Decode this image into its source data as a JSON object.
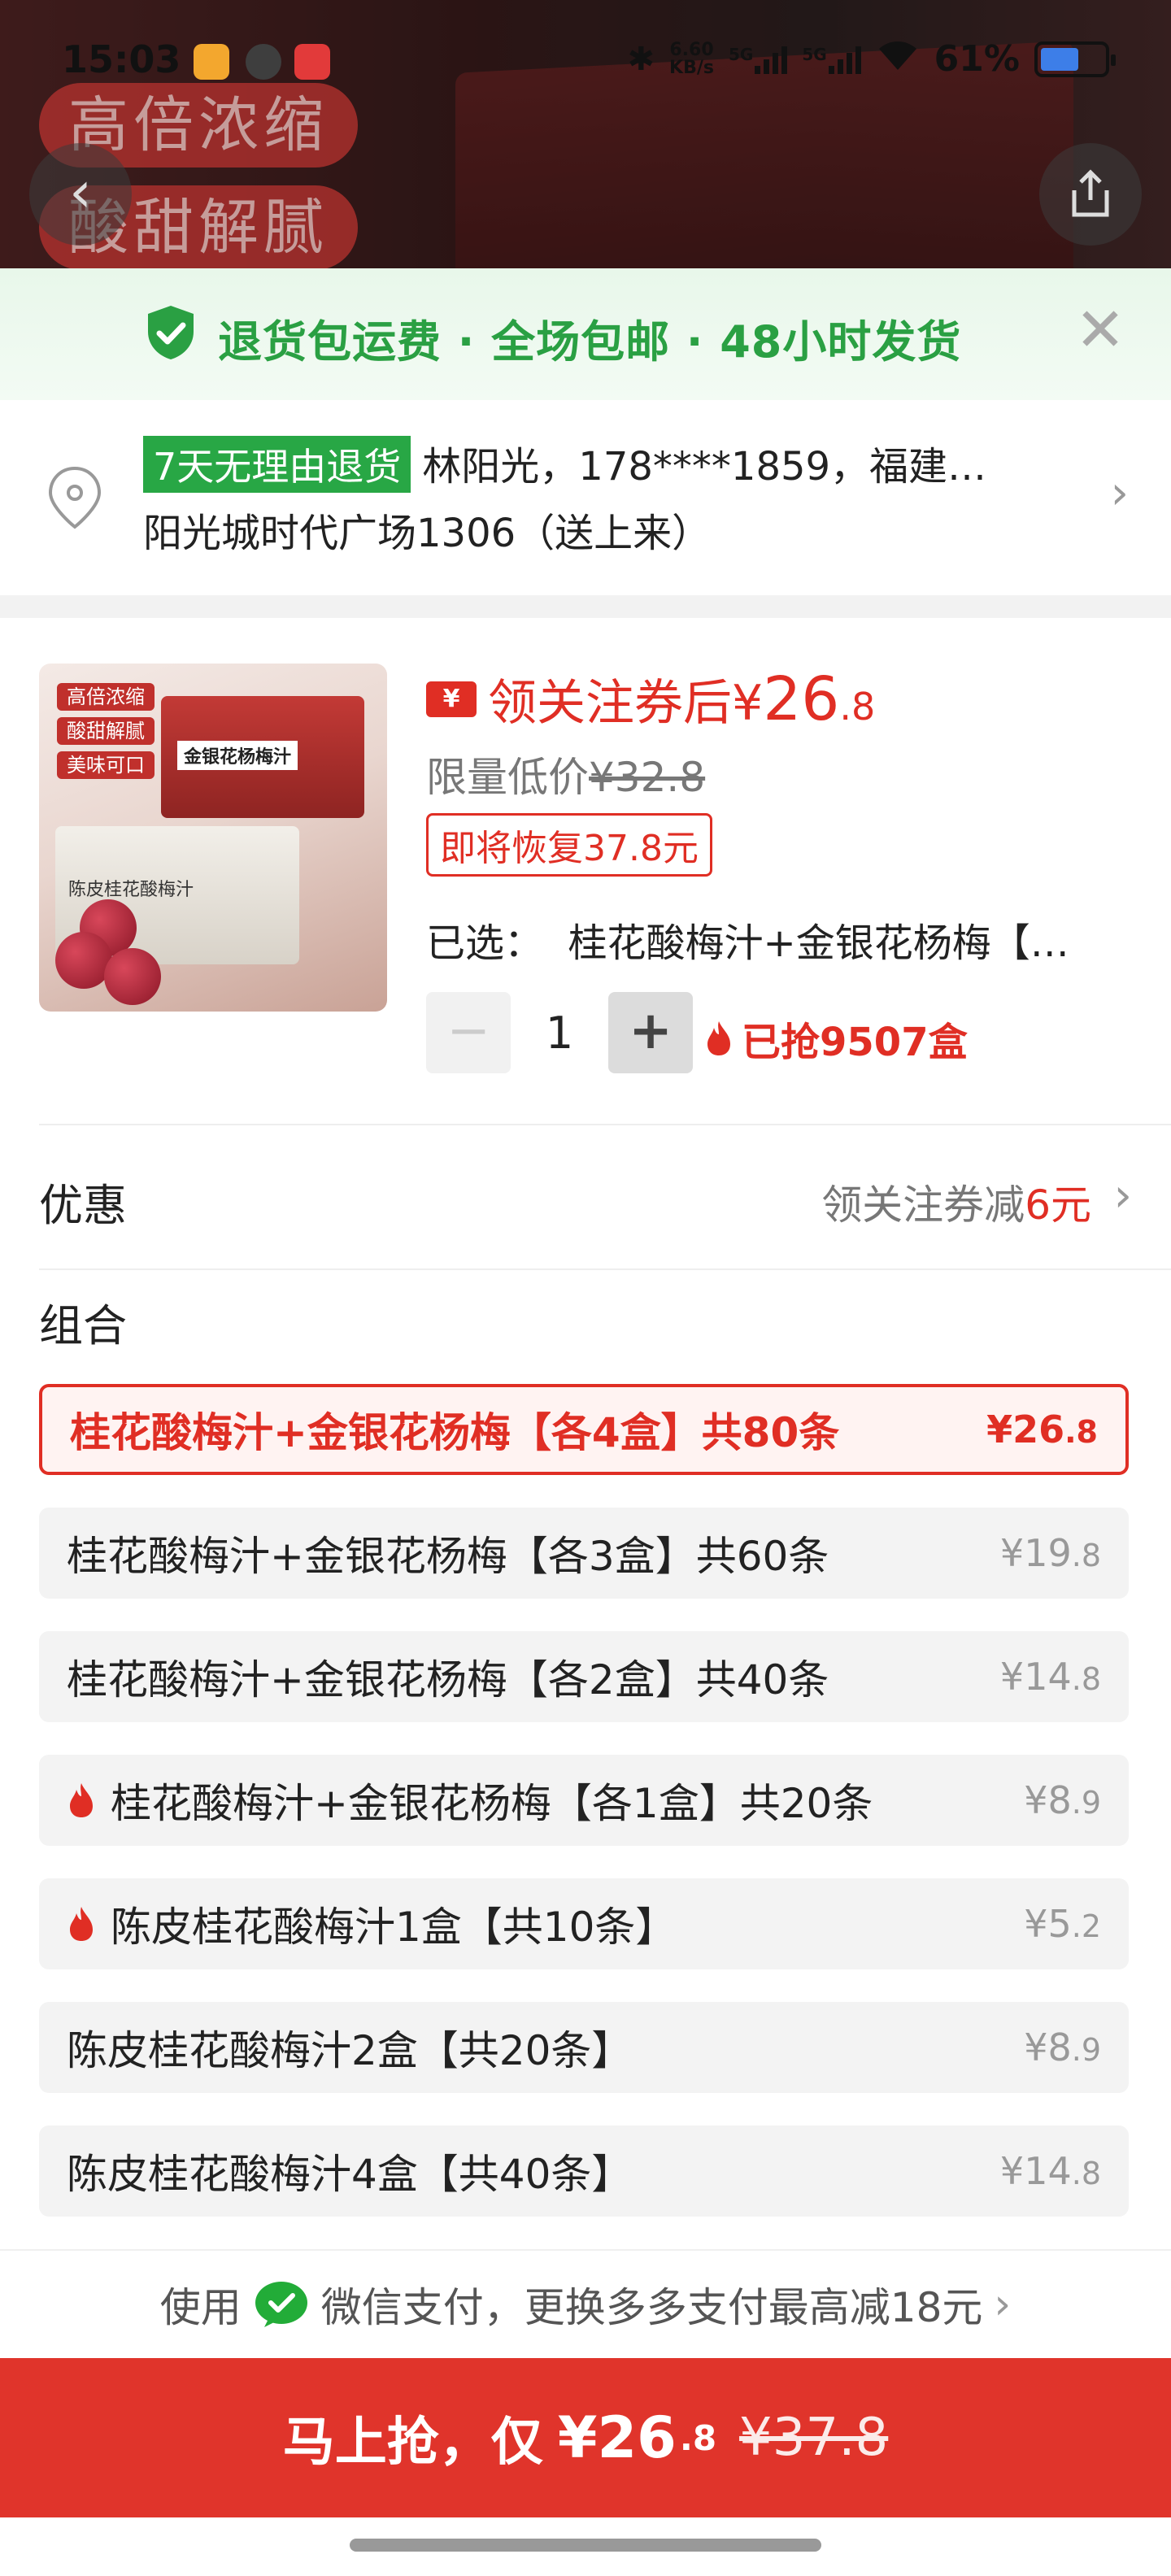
{
  "status_bar": {
    "time": "15:03",
    "net_speed_value": "6.60",
    "net_speed_unit": "KB/s",
    "signal1": "5G",
    "signal2": "5G",
    "battery": "61%",
    "battery_level": 0.61
  },
  "hero": {
    "tag1": "高倍浓缩",
    "tag2": "酸甜解腻"
  },
  "promo_banner": {
    "text": "退货包运费 · 全场包邮 · 48小时发货",
    "accent": "#2aa043"
  },
  "address": {
    "badge": "7天无理由退货",
    "line1": "林阳光，178****1859，福建…",
    "line2": "阳光城时代广场1306（送上来）"
  },
  "product": {
    "thumb_tags": [
      "高倍浓缩",
      "酸甜解腻",
      "美味可口"
    ],
    "thumb_box_a": "金银花杨梅汁",
    "thumb_box_b": "陈皮桂花酸梅汁",
    "coupon_icon": "¥",
    "price_label": "领关注券后",
    "price_currency": "¥",
    "price_int": "26",
    "price_dec": ".8",
    "limit_label": "限量低价",
    "limit_price": "¥32.8",
    "restore": "即将恢复37.8元",
    "selected_label": "已选：",
    "selected_value": "桂花酸梅汁+金银花杨梅【…",
    "quantity": "1",
    "minus": "−",
    "plus": "+",
    "sold": "已抢9507盒"
  },
  "offer": {
    "title": "优惠",
    "value_prefix": "领关注券减",
    "value_amount": "6元"
  },
  "combo": {
    "title": "组合",
    "options": [
      {
        "name": "桂花酸梅汁+金银花杨梅【各4盒】共80条",
        "price_int": "¥26",
        "price_dec": ".8",
        "selected": true,
        "hot": false
      },
      {
        "name": "桂花酸梅汁+金银花杨梅【各3盒】共60条",
        "price_int": "¥19",
        "price_dec": ".8",
        "selected": false,
        "hot": false
      },
      {
        "name": "桂花酸梅汁+金银花杨梅【各2盒】共40条",
        "price_int": "¥14",
        "price_dec": ".8",
        "selected": false,
        "hot": false
      },
      {
        "name": "桂花酸梅汁+金银花杨梅【各1盒】共20条",
        "price_int": "¥8",
        "price_dec": ".9",
        "selected": false,
        "hot": true
      },
      {
        "name": "陈皮桂花酸梅汁1盒【共10条】",
        "price_int": "¥5",
        "price_dec": ".2",
        "selected": false,
        "hot": true
      },
      {
        "name": "陈皮桂花酸梅汁2盒【共20条】",
        "price_int": "¥8",
        "price_dec": ".9",
        "selected": false,
        "hot": false
      },
      {
        "name": "陈皮桂花酸梅汁4盒【共40条】",
        "price_int": "¥14",
        "price_dec": ".8",
        "selected": false,
        "hot": false
      }
    ]
  },
  "payment": {
    "prefix": "使用",
    "text": "微信支付，更换多多支付最高减18元"
  },
  "buy_button": {
    "label": "马上抢，仅",
    "price_int": "¥26",
    "price_dec": ".8",
    "old_price": "¥37.8"
  },
  "colors": {
    "accent_red": "#e02e24",
    "green": "#2aa043"
  }
}
